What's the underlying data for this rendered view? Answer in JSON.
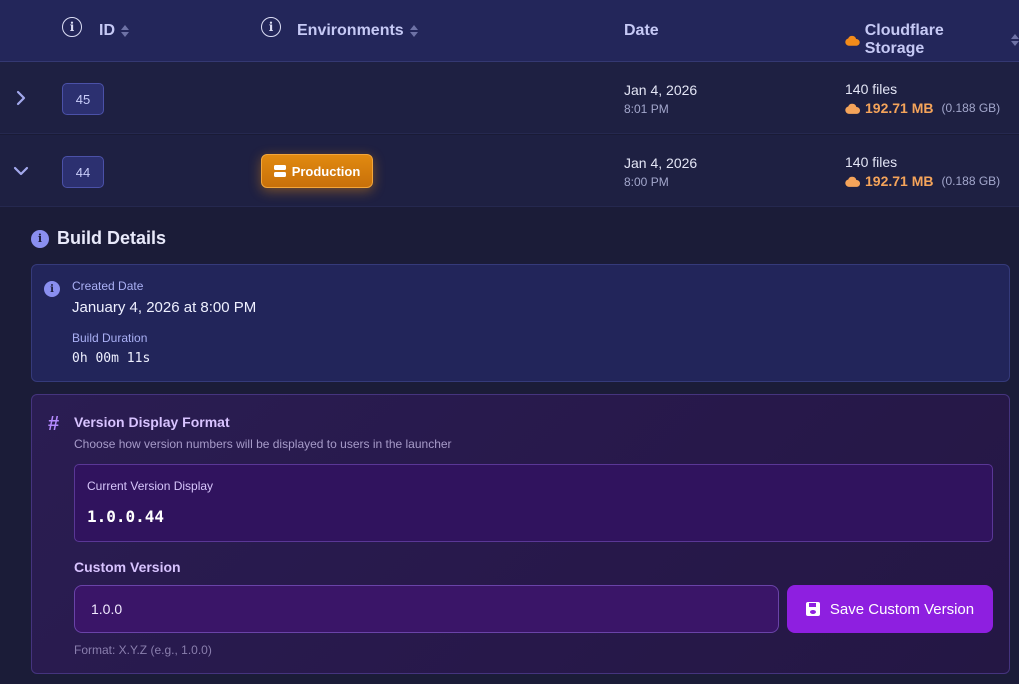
{
  "table": {
    "headers": {
      "id": "ID",
      "environments": "Environments",
      "date": "Date",
      "storage": "Cloudflare Storage"
    },
    "rows": [
      {
        "id": "45",
        "environment": "",
        "date": "Jan 4, 2026",
        "time": "8:01 PM",
        "files": "140 files",
        "size": "192.71 MB",
        "size_gb": "(0.188 GB)",
        "expanded": false
      },
      {
        "id": "44",
        "environment": "Production",
        "date": "Jan 4, 2026",
        "time": "8:00 PM",
        "files": "140 files",
        "size": "192.71 MB",
        "size_gb": "(0.188 GB)",
        "expanded": true
      }
    ]
  },
  "details": {
    "title": "Build Details",
    "created_label": "Created Date",
    "created_value": "January 4, 2026 at 8:00 PM",
    "duration_label": "Build Duration",
    "duration_value": "0h 00m 11s"
  },
  "version_format": {
    "title": "Version Display Format",
    "description": "Choose how version numbers will be displayed to users in the launcher",
    "current_label": "Current Version Display",
    "current_value": "1.0.0.44",
    "custom_label": "Custom Version",
    "custom_input_value": "1.0.0",
    "save_label": "Save Custom Version",
    "hint": "Format: X.Y.Z (e.g., 1.0.0)"
  },
  "colors": {
    "accent_purple": "#8e1fe0",
    "production_orange": "#e18a10",
    "storage_orange": "#f5a45a"
  },
  "icons": {
    "info": "info-icon",
    "sort": "sort-icon",
    "cloud": "cloud-icon",
    "chevron_right": "chevron-right-icon",
    "chevron_down": "chevron-down-icon",
    "server": "server-icon",
    "hash": "hash-icon",
    "save": "floppy-disk-icon"
  }
}
